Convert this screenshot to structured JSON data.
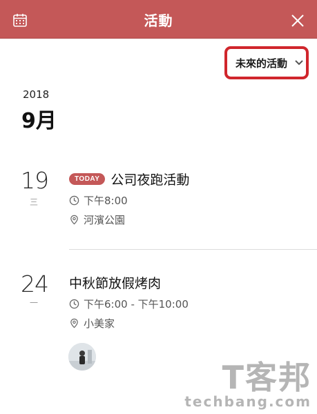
{
  "header": {
    "title": "活動",
    "calendar_icon": "calendar-icon",
    "close_icon": "close-icon"
  },
  "filter": {
    "label": "未來的活動",
    "icon": "chevron-down-icon"
  },
  "section": {
    "year": "2018",
    "month": "9月"
  },
  "events": [
    {
      "day": "19",
      "weekday": "三",
      "badge": "TODAY",
      "title": "公司夜跑活動",
      "time": "下午8:00",
      "location": "河濱公園"
    },
    {
      "day": "24",
      "weekday": "一",
      "title": "中秋節放假烤肉",
      "time": "下午6:00 - 下午10:00",
      "location": "小美家"
    }
  ],
  "watermark": {
    "text_cn": "T客邦",
    "text_en": "techbang.com"
  },
  "colors": {
    "header": "#c45858",
    "highlight_box": "#d0262c",
    "badge": "#c45858"
  }
}
